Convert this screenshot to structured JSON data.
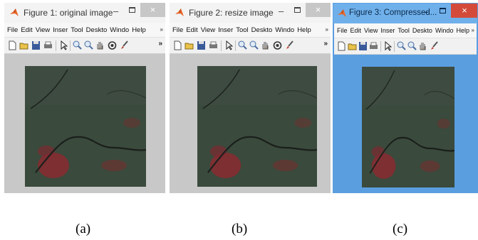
{
  "windows": [
    {
      "title": "Figure 1: original image",
      "menus": [
        "File",
        "Edit",
        "View",
        "Inser",
        "Tool",
        "Deskto",
        "Windo",
        "Help"
      ],
      "caption": "(a)",
      "active": false
    },
    {
      "title": "Figure 2: resize image",
      "menus": [
        "File",
        "Edit",
        "View",
        "Inser",
        "Tool",
        "Deskto",
        "Windo",
        "Help"
      ],
      "caption": "(b)",
      "active": false
    },
    {
      "title": "Figure 3: Compressed...",
      "menus": [
        "File",
        "Edit",
        "View",
        "Inser",
        "Tool",
        "Deskto",
        "Windo",
        "Help"
      ],
      "caption": "(c)",
      "active": true
    }
  ],
  "titlebar_buttons": {
    "minimize": "–",
    "close": "×"
  },
  "menu_overflow": "»",
  "toolbar_overflow": "»",
  "colors": {
    "window_bg": "#c8c8c8",
    "active_border": "#5a9ee0",
    "close_active": "#d44a3a",
    "image_base": "#3a4a3c",
    "image_red": "#8a2a30"
  },
  "icons": [
    "matlab-logo-icon",
    "new-figure-icon",
    "open-file-icon",
    "save-icon",
    "print-icon",
    "pointer-icon",
    "zoom-in-icon",
    "zoom-out-icon",
    "pan-icon",
    "rotate-3d-icon",
    "brush-icon"
  ]
}
